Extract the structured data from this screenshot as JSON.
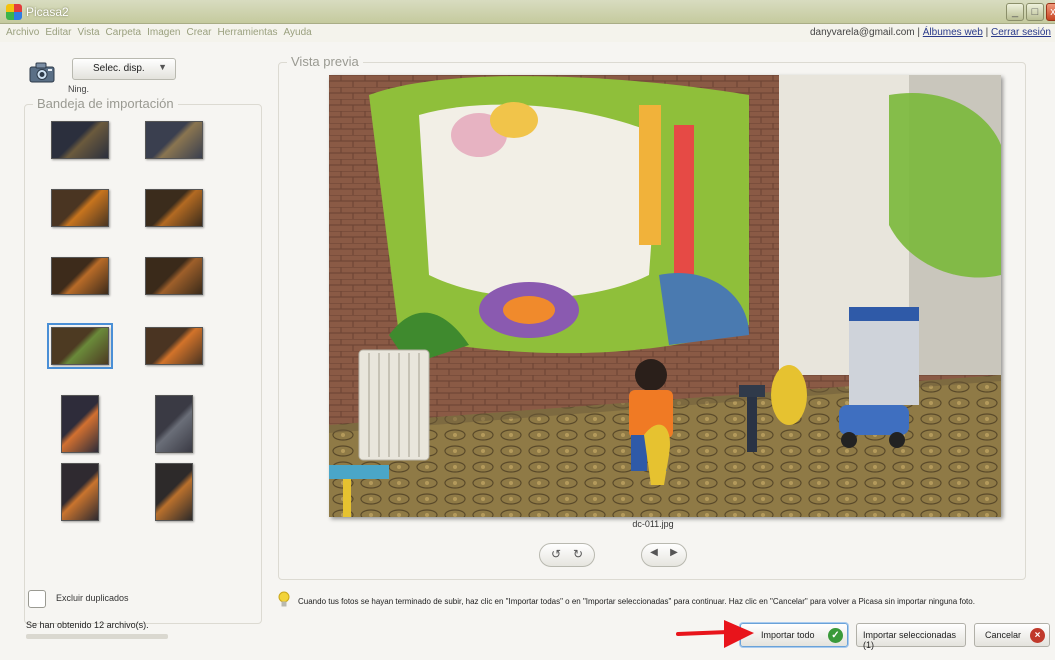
{
  "window": {
    "title": "Picasa2",
    "controls": {
      "minimize": "_",
      "maximize": "□",
      "close": "x"
    }
  },
  "menu": {
    "items": [
      "Archivo",
      "Editar",
      "Vista",
      "Carpeta",
      "Imagen",
      "Crear",
      "Herramientas",
      "Ayuda"
    ]
  },
  "account": {
    "email": "danyvarela@gmail.com",
    "separator": "|",
    "web_albums": "Álbumes web",
    "sign_out": "Cerrar sesión"
  },
  "device": {
    "icon": "camera-icon",
    "select_label": "Selec. disp.",
    "status": "Ning."
  },
  "tray": {
    "title": "Bandeja de importación",
    "thumbnails": [
      {
        "orientation": "landscape",
        "selected": false,
        "colors": [
          "#2b2f3d",
          "#6b5a3d"
        ]
      },
      {
        "orientation": "landscape",
        "selected": false,
        "colors": [
          "#3a3f4f",
          "#8a7550"
        ]
      },
      {
        "orientation": "landscape",
        "selected": false,
        "colors": [
          "#4a3522",
          "#c7741e"
        ]
      },
      {
        "orientation": "landscape",
        "selected": false,
        "colors": [
          "#3b2c1c",
          "#b36a22"
        ]
      },
      {
        "orientation": "landscape",
        "selected": false,
        "colors": [
          "#3d2b1b",
          "#b86b28"
        ]
      },
      {
        "orientation": "landscape",
        "selected": false,
        "colors": [
          "#3a2a1a",
          "#9e5f2a"
        ]
      },
      {
        "orientation": "landscape",
        "selected": true,
        "colors": [
          "#4d3a22",
          "#6a8a3a"
        ]
      },
      {
        "orientation": "landscape",
        "selected": false,
        "colors": [
          "#4a3422",
          "#d2732a"
        ]
      },
      {
        "orientation": "portrait",
        "selected": false,
        "colors": [
          "#2e2c3a",
          "#d27030"
        ]
      },
      {
        "orientation": "portrait",
        "selected": false,
        "colors": [
          "#3a3a44",
          "#6a6e78"
        ]
      },
      {
        "orientation": "portrait",
        "selected": false,
        "colors": [
          "#2f2a30",
          "#c9742e"
        ]
      },
      {
        "orientation": "portrait",
        "selected": false,
        "colors": [
          "#2d2a2a",
          "#b9702c"
        ]
      }
    ]
  },
  "preview": {
    "title": "Vista previa",
    "filename": "dc-011.jpg"
  },
  "controls": {
    "rotate_left": "↺",
    "rotate_right": "↻",
    "previous": "◀",
    "next": "▶"
  },
  "options": {
    "exclude_duplicates": "Excluir duplicados",
    "status": "Se han obtenido 12 archivo(s).",
    "progress": 0
  },
  "instructions": "Cuando tus fotos se hayan terminado de subir, haz clic en \"Importar todas\" o en \"Importar seleccionadas\" para continuar. Haz clic en \"Cancelar\" para volver a Picasa sin importar ninguna foto.",
  "buttons": {
    "import_all": "Importar todo",
    "import_selected": "Importar seleccionadas (1)",
    "cancel": "Cancelar"
  },
  "colors": {
    "accent_blue": "#4a8fd6",
    "ok_green": "#3a9a3a",
    "cancel_red": "#c0392b",
    "annotation_red": "#e8141b"
  }
}
